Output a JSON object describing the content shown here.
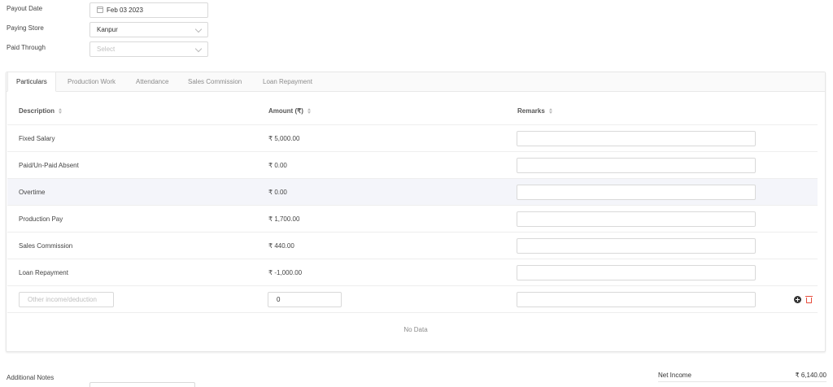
{
  "form": {
    "payout_date_label": "Payout Date",
    "payout_date_value": "Feb 03 2023",
    "paying_store_label": "Paying Store",
    "paying_store_value": "Kanpur",
    "paid_through_label": "Paid Through",
    "paid_through_placeholder": "Select"
  },
  "tabs": [
    {
      "label": "Particulars",
      "active": true
    },
    {
      "label": "Production Work",
      "active": false
    },
    {
      "label": "Attendance",
      "active": false
    },
    {
      "label": "Sales Commission",
      "active": false
    },
    {
      "label": "Loan Repayment",
      "active": false
    }
  ],
  "table": {
    "columns": [
      "Description",
      "Amount (₹)",
      "Remarks"
    ],
    "rows": [
      {
        "description": "Fixed Salary",
        "amount": "₹ 5,000.00",
        "remarks": ""
      },
      {
        "description": "Paid/Un-Paid Absent",
        "amount": "₹ 0.00",
        "remarks": ""
      },
      {
        "description": "Overtime",
        "amount": "₹ 0.00",
        "remarks": ""
      },
      {
        "description": "Production Pay",
        "amount": "₹ 1,700.00",
        "remarks": ""
      },
      {
        "description": "Sales Commission",
        "amount": "₹ 440.00",
        "remarks": ""
      },
      {
        "description": "Loan Repayment",
        "amount": "₹ -1,000.00",
        "remarks": ""
      }
    ],
    "editable_row": {
      "description_placeholder": "Other income/deduction",
      "amount_value": "0",
      "remarks": ""
    },
    "empty_text": "No Data"
  },
  "footer": {
    "notes_label": "Additional Notes",
    "net_income_label": "Net Income",
    "net_income_value": "₹ 6,140.00"
  },
  "colors": {
    "highlight_row": "#f4f5fa",
    "delete": "#e74c3c"
  }
}
